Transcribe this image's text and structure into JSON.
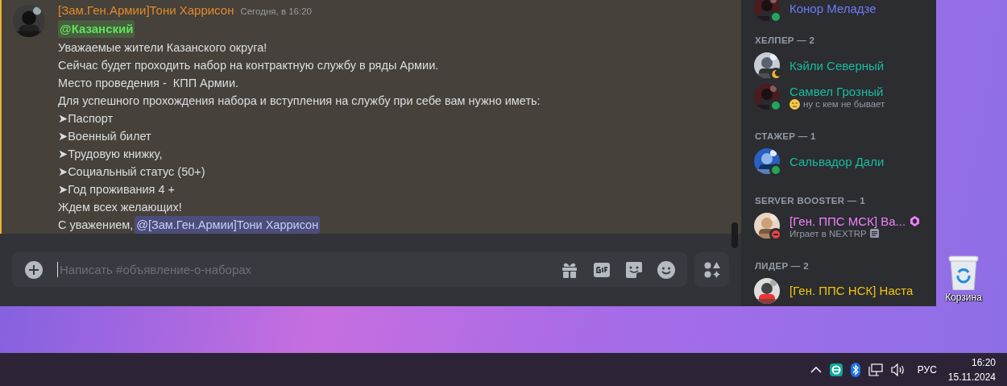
{
  "message": {
    "author": "[Зам.Ген.Армии]Тони Харрисон",
    "timestamp": "Сегодня, в 16:20",
    "mention": "@Казанский",
    "lines": [
      "Уважаемые жители Казанского округа!",
      "Сейчас будет проходить набор на контрактную службу в ряды Армии.",
      "Место проведения -  КПП Армии.",
      "Для успешного прохождения набора и вступления на службу при себе вам нужно иметь:",
      "➤Паспорт",
      "➤Военный билет",
      "➤Трудовую книжку,",
      "➤Социальный статус (50+)",
      "➤Год проживания 4 +",
      "Ждем всех желающих!"
    ],
    "signature": "С уважением,",
    "signature_mention": "@[Зам.Ген.Армии]Тони Харрисон"
  },
  "composer": {
    "placeholder": "Написать #объявление-о-наборах"
  },
  "member_list": {
    "top_member": {
      "name": "Конор Меладзе",
      "color": "#6f7bf7",
      "status": {
        "kind": "online",
        "color": "#23a55a"
      }
    },
    "groups": [
      {
        "title": "ХЕЛПЕР — 2",
        "members": [
          {
            "name": "Кэйли Северный",
            "color": "#1abc9c",
            "status": {
              "kind": "idle",
              "color": "#f0b232"
            }
          },
          {
            "name": "Самвел Грозный",
            "color": "#1abc9c",
            "status": {
              "kind": "online",
              "color": "#23a55a"
            },
            "activity": {
              "kind": "emoji",
              "text": "ну с кем не бывает"
            }
          }
        ]
      },
      {
        "title": "СТАЖЕР — 1",
        "members": [
          {
            "name": "Сальвадор Дали",
            "color": "#1abc9c",
            "status": {
              "kind": "online",
              "color": "#23a55a"
            }
          }
        ]
      },
      {
        "title": "SERVER BOOSTER — 1",
        "members": [
          {
            "name": "[Ген. ППС МСК] Ва...",
            "color": "#f47fff",
            "status": {
              "kind": "dnd",
              "color": "#f23f43"
            },
            "booster": true,
            "activity": {
              "kind": "game",
              "text": "Играет в NEXTRP"
            }
          }
        ]
      },
      {
        "title": "ЛИДЕР — 2",
        "members": [
          {
            "name": "[Ген. ППС НСК] Наста",
            "color": "#f1c40f"
          }
        ]
      }
    ]
  },
  "desktop": {
    "recycle_bin": "Корзина"
  },
  "taskbar": {
    "language": "РУС",
    "time": "16:20",
    "date": "15.11.2024"
  }
}
